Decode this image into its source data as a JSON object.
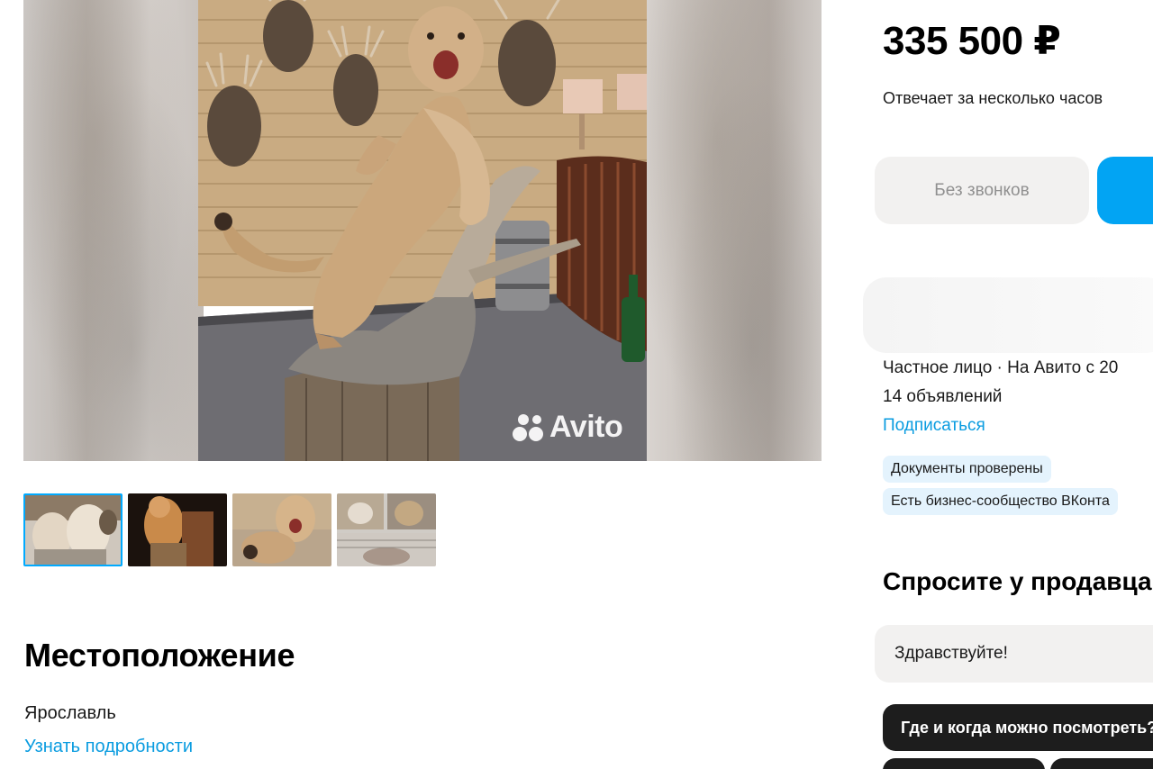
{
  "listing": {
    "price": "335 500 ₽",
    "response_time": "Отвечает за несколько часов",
    "watermark": "Avito"
  },
  "actions": {
    "no_calls_label": "Без звонков",
    "write_label": ""
  },
  "seller": {
    "meta": "Частное лицо · На Авито с 20",
    "listings_count": "14 объявлений",
    "subscribe_label": "Подписаться",
    "badges": [
      "Документы проверены",
      "Есть бизнес-сообщество ВКонта"
    ]
  },
  "ask": {
    "title": "Спросите у продавца",
    "input_value": "Здравствуйте!",
    "chips": [
      "Где и когда можно посмотреть?",
      "",
      ""
    ]
  },
  "location": {
    "title": "Местоположение",
    "city": "Ярославль",
    "details_link": "Узнать подробности"
  },
  "gallery": {
    "thumbnail_count": 4,
    "active_thumbnail": 1
  },
  "colors": {
    "accent": "#00aaff",
    "link": "#0a9ce0",
    "primary_button": "#02a4f3",
    "badge_bg": "#e4f3fd",
    "chip_bg": "#1d1d1d"
  }
}
